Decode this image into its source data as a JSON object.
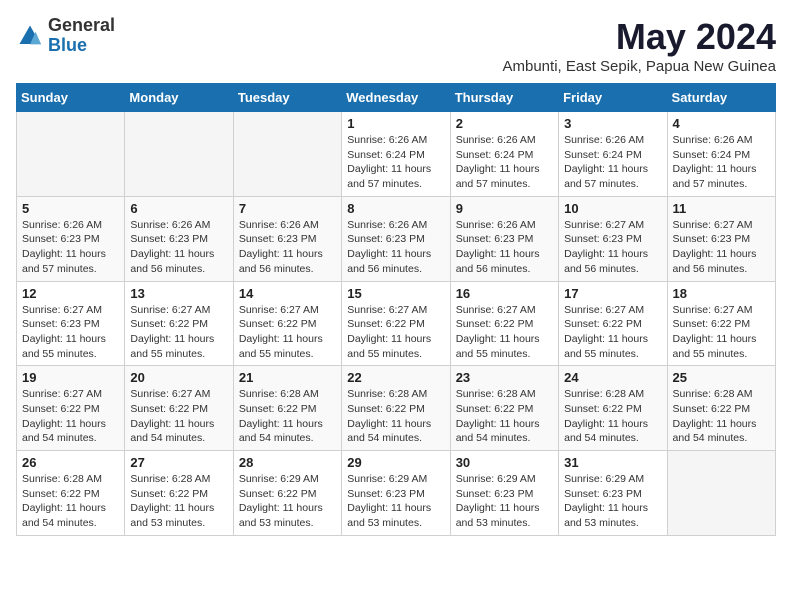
{
  "logo": {
    "general": "General",
    "blue": "Blue"
  },
  "title": "May 2024",
  "subtitle": "Ambunti, East Sepik, Papua New Guinea",
  "weekdays": [
    "Sunday",
    "Monday",
    "Tuesday",
    "Wednesday",
    "Thursday",
    "Friday",
    "Saturday"
  ],
  "weeks": [
    [
      {
        "day": "",
        "info": ""
      },
      {
        "day": "",
        "info": ""
      },
      {
        "day": "",
        "info": ""
      },
      {
        "day": "1",
        "info": "Sunrise: 6:26 AM\nSunset: 6:24 PM\nDaylight: 11 hours and 57 minutes."
      },
      {
        "day": "2",
        "info": "Sunrise: 6:26 AM\nSunset: 6:24 PM\nDaylight: 11 hours and 57 minutes."
      },
      {
        "day": "3",
        "info": "Sunrise: 6:26 AM\nSunset: 6:24 PM\nDaylight: 11 hours and 57 minutes."
      },
      {
        "day": "4",
        "info": "Sunrise: 6:26 AM\nSunset: 6:24 PM\nDaylight: 11 hours and 57 minutes."
      }
    ],
    [
      {
        "day": "5",
        "info": "Sunrise: 6:26 AM\nSunset: 6:23 PM\nDaylight: 11 hours and 57 minutes."
      },
      {
        "day": "6",
        "info": "Sunrise: 6:26 AM\nSunset: 6:23 PM\nDaylight: 11 hours and 56 minutes."
      },
      {
        "day": "7",
        "info": "Sunrise: 6:26 AM\nSunset: 6:23 PM\nDaylight: 11 hours and 56 minutes."
      },
      {
        "day": "8",
        "info": "Sunrise: 6:26 AM\nSunset: 6:23 PM\nDaylight: 11 hours and 56 minutes."
      },
      {
        "day": "9",
        "info": "Sunrise: 6:26 AM\nSunset: 6:23 PM\nDaylight: 11 hours and 56 minutes."
      },
      {
        "day": "10",
        "info": "Sunrise: 6:27 AM\nSunset: 6:23 PM\nDaylight: 11 hours and 56 minutes."
      },
      {
        "day": "11",
        "info": "Sunrise: 6:27 AM\nSunset: 6:23 PM\nDaylight: 11 hours and 56 minutes."
      }
    ],
    [
      {
        "day": "12",
        "info": "Sunrise: 6:27 AM\nSunset: 6:23 PM\nDaylight: 11 hours and 55 minutes."
      },
      {
        "day": "13",
        "info": "Sunrise: 6:27 AM\nSunset: 6:22 PM\nDaylight: 11 hours and 55 minutes."
      },
      {
        "day": "14",
        "info": "Sunrise: 6:27 AM\nSunset: 6:22 PM\nDaylight: 11 hours and 55 minutes."
      },
      {
        "day": "15",
        "info": "Sunrise: 6:27 AM\nSunset: 6:22 PM\nDaylight: 11 hours and 55 minutes."
      },
      {
        "day": "16",
        "info": "Sunrise: 6:27 AM\nSunset: 6:22 PM\nDaylight: 11 hours and 55 minutes."
      },
      {
        "day": "17",
        "info": "Sunrise: 6:27 AM\nSunset: 6:22 PM\nDaylight: 11 hours and 55 minutes."
      },
      {
        "day": "18",
        "info": "Sunrise: 6:27 AM\nSunset: 6:22 PM\nDaylight: 11 hours and 55 minutes."
      }
    ],
    [
      {
        "day": "19",
        "info": "Sunrise: 6:27 AM\nSunset: 6:22 PM\nDaylight: 11 hours and 54 minutes."
      },
      {
        "day": "20",
        "info": "Sunrise: 6:27 AM\nSunset: 6:22 PM\nDaylight: 11 hours and 54 minutes."
      },
      {
        "day": "21",
        "info": "Sunrise: 6:28 AM\nSunset: 6:22 PM\nDaylight: 11 hours and 54 minutes."
      },
      {
        "day": "22",
        "info": "Sunrise: 6:28 AM\nSunset: 6:22 PM\nDaylight: 11 hours and 54 minutes."
      },
      {
        "day": "23",
        "info": "Sunrise: 6:28 AM\nSunset: 6:22 PM\nDaylight: 11 hours and 54 minutes."
      },
      {
        "day": "24",
        "info": "Sunrise: 6:28 AM\nSunset: 6:22 PM\nDaylight: 11 hours and 54 minutes."
      },
      {
        "day": "25",
        "info": "Sunrise: 6:28 AM\nSunset: 6:22 PM\nDaylight: 11 hours and 54 minutes."
      }
    ],
    [
      {
        "day": "26",
        "info": "Sunrise: 6:28 AM\nSunset: 6:22 PM\nDaylight: 11 hours and 54 minutes."
      },
      {
        "day": "27",
        "info": "Sunrise: 6:28 AM\nSunset: 6:22 PM\nDaylight: 11 hours and 53 minutes."
      },
      {
        "day": "28",
        "info": "Sunrise: 6:29 AM\nSunset: 6:22 PM\nDaylight: 11 hours and 53 minutes."
      },
      {
        "day": "29",
        "info": "Sunrise: 6:29 AM\nSunset: 6:23 PM\nDaylight: 11 hours and 53 minutes."
      },
      {
        "day": "30",
        "info": "Sunrise: 6:29 AM\nSunset: 6:23 PM\nDaylight: 11 hours and 53 minutes."
      },
      {
        "day": "31",
        "info": "Sunrise: 6:29 AM\nSunset: 6:23 PM\nDaylight: 11 hours and 53 minutes."
      },
      {
        "day": "",
        "info": ""
      }
    ]
  ]
}
